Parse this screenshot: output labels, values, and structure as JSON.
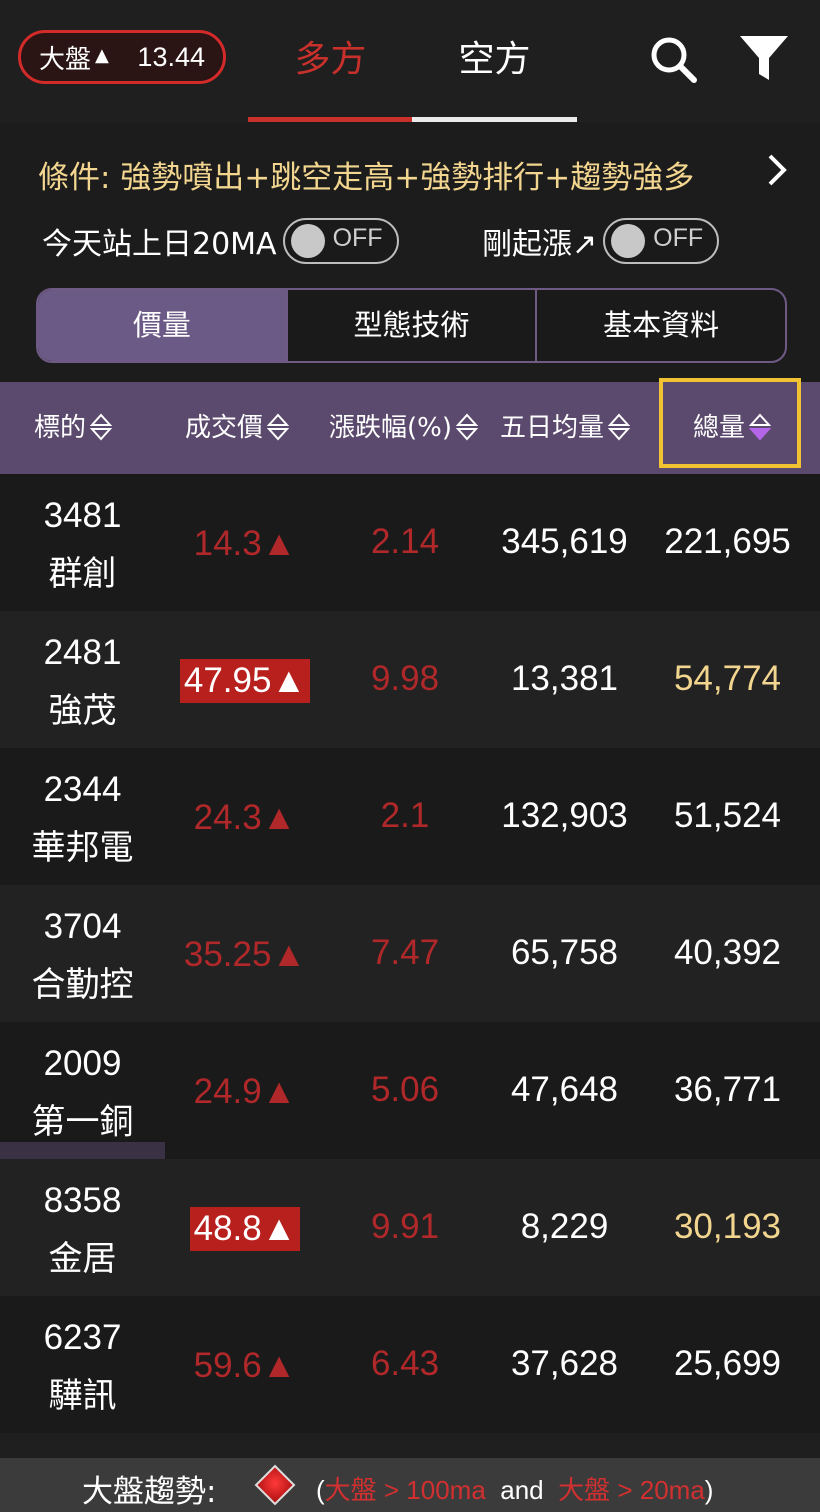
{
  "header": {
    "market_label": "大盤",
    "market_arrow": "▲",
    "market_value": "13.44",
    "tab_long": "多方",
    "tab_short": "空方",
    "icons": [
      "search-icon",
      "filter-icon"
    ]
  },
  "conditions": {
    "text": "條件: 強勢噴出+跳空走高+強勢排行+趨勢強多",
    "toggle1_label": "今天站上日20MA",
    "toggle1_state": "OFF",
    "toggle2_label": "剛起漲↗",
    "toggle2_state": "OFF"
  },
  "segments": [
    "價量",
    "型態技術",
    "基本資料"
  ],
  "table": {
    "headers": [
      "標的",
      "成交價",
      "漲跌幅(%)",
      "五日均量",
      "總量"
    ],
    "rows": [
      {
        "code": "3481",
        "name": "群創",
        "price": "14.3▲",
        "price_limit": false,
        "change": "2.14",
        "avg5": "345,619",
        "volume": "221,695",
        "volume_gold": false
      },
      {
        "code": "2481",
        "name": "強茂",
        "price": "47.95▲",
        "price_limit": true,
        "change": "9.98",
        "avg5": "13,381",
        "volume": "54,774",
        "volume_gold": true
      },
      {
        "code": "2344",
        "name": "華邦電",
        "price": "24.3▲",
        "price_limit": false,
        "change": "2.1",
        "avg5": "132,903",
        "volume": "51,524",
        "volume_gold": false
      },
      {
        "code": "3704",
        "name": "合勤控",
        "price": "35.25▲",
        "price_limit": false,
        "change": "7.47",
        "avg5": "65,758",
        "volume": "40,392",
        "volume_gold": false
      },
      {
        "code": "2009",
        "name": "第一銅",
        "price": "24.9▲",
        "price_limit": false,
        "change": "5.06",
        "avg5": "47,648",
        "volume": "36,771",
        "volume_gold": false
      },
      {
        "code": "8358",
        "name": "金居",
        "price": "48.8▲",
        "price_limit": true,
        "change": "9.91",
        "avg5": "8,229",
        "volume": "30,193",
        "volume_gold": true
      },
      {
        "code": "6237",
        "name": "驊訊",
        "price": "59.6▲",
        "price_limit": false,
        "change": "6.43",
        "avg5": "37,628",
        "volume": "25,699",
        "volume_gold": false
      }
    ]
  },
  "footer": {
    "label": "大盤趨勢:",
    "open_paren": "(",
    "cond1": "大盤 > 100ma",
    "and": "and",
    "cond2": "大盤 > 20ma",
    "close_paren": ")"
  },
  "colors": {
    "up_red": "#b0282a",
    "limit_bg": "#b8201e",
    "gold": "#f2d58f",
    "header_purple": "#5b4a6e",
    "highlight": "#f1c232"
  }
}
